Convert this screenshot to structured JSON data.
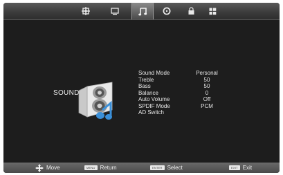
{
  "tabs": [
    {
      "icon": "picture-settings-icon"
    },
    {
      "icon": "monitor-icon"
    },
    {
      "icon": "music-note-icon",
      "active": true
    },
    {
      "icon": "clock-icon"
    },
    {
      "icon": "lock-icon"
    },
    {
      "icon": "grid-icon"
    }
  ],
  "section": {
    "title": "SOUND",
    "icon": "speaker-icon"
  },
  "menu": {
    "items": [
      {
        "label": "Sound Mode",
        "value": "Personal"
      },
      {
        "label": "Treble",
        "value": "50"
      },
      {
        "label": "Bass",
        "value": "50"
      },
      {
        "label": "Balance",
        "value": "0"
      },
      {
        "label": "Auto Volume",
        "value": "Off"
      },
      {
        "label": "SPDIF Mode",
        "value": "PCM"
      },
      {
        "label": "AD Switch",
        "value": ""
      }
    ]
  },
  "footer": {
    "move_label": "Move",
    "return_key": "MENU",
    "return_label": "Return",
    "select_key": "ENTER",
    "select_label": "Select",
    "exit_key": "EXIT",
    "exit_label": "Exit"
  }
}
